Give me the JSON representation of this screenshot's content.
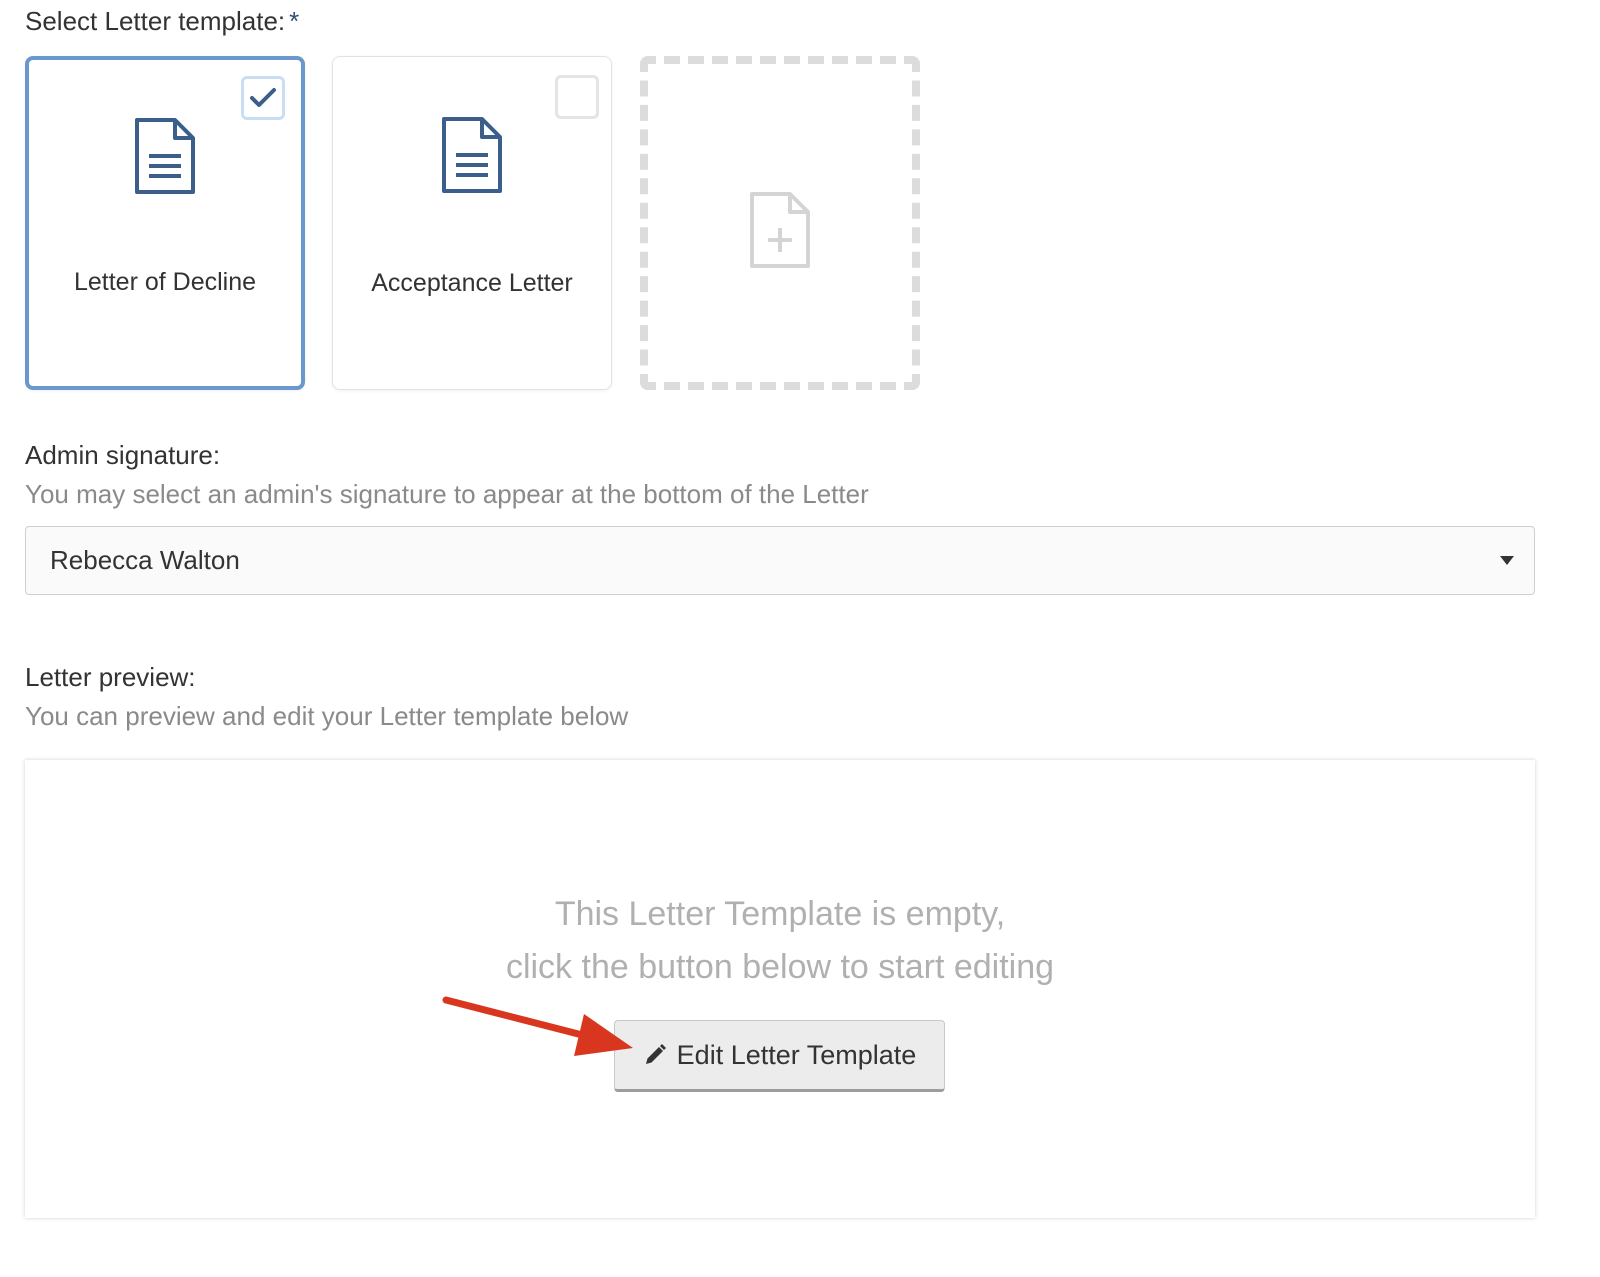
{
  "template_section": {
    "label": "Select Letter template:",
    "required_mark": "*",
    "cards": [
      {
        "label": "Letter of Decline",
        "selected": true
      },
      {
        "label": "Acceptance Letter",
        "selected": false
      }
    ],
    "add_card_icon": "file-plus-icon"
  },
  "signature_section": {
    "label": "Admin signature:",
    "help": "You may select an admin's signature to appear at the bottom of the Letter",
    "selected_value": "Rebecca Walton"
  },
  "preview_section": {
    "label": "Letter preview:",
    "help": "You can preview and edit your Letter template below",
    "empty_line1": "This Letter Template is empty,",
    "empty_line2": "click the button below to start editing",
    "edit_button_label": "Edit Letter Template"
  },
  "colors": {
    "selected_border": "#6a98cc",
    "icon_blue": "#3b5f8a",
    "annotation_arrow": "#d8361f"
  }
}
